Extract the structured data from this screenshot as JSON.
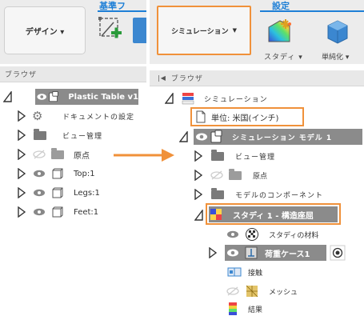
{
  "left": {
    "ribbon": {
      "design_button": "デザイン ▾",
      "group_label": "基準フ"
    },
    "browser_label": "ブラウザ",
    "tree": {
      "root": "Plastic Table v1",
      "items": [
        {
          "label": "ドキュメントの設定"
        },
        {
          "label": "ビュー管理"
        },
        {
          "label": "原点"
        },
        {
          "label": "Top:1"
        },
        {
          "label": "Legs:1"
        },
        {
          "label": "Feet:1"
        }
      ]
    }
  },
  "right": {
    "ribbon": {
      "simulation_button": "シミュレーション",
      "group_label": "設定",
      "study_label": "スタディ ▾",
      "simplify_label": "単純化 ▾"
    },
    "browser_label": "ブラウザ",
    "tree": {
      "root": "シミュレーション",
      "units": "単位: 米国(インチ)",
      "model": "シミュレーション モデル 1",
      "model_items": [
        {
          "label": "ビュー管理"
        },
        {
          "label": "原点"
        },
        {
          "label": "モデルのコンポーネント"
        }
      ],
      "study": "スタディ 1 - 構造座屈",
      "study_items": [
        {
          "label": "スタディの材料"
        },
        {
          "label": "荷重ケース1"
        },
        {
          "label": "接触"
        },
        {
          "label": "メッシュ"
        },
        {
          "label": "結果"
        }
      ]
    }
  },
  "colors": {
    "accent_orange": "#f0913a",
    "ribbon_blue": "#1e7fd6",
    "dark_row": "#8b8b8b"
  }
}
